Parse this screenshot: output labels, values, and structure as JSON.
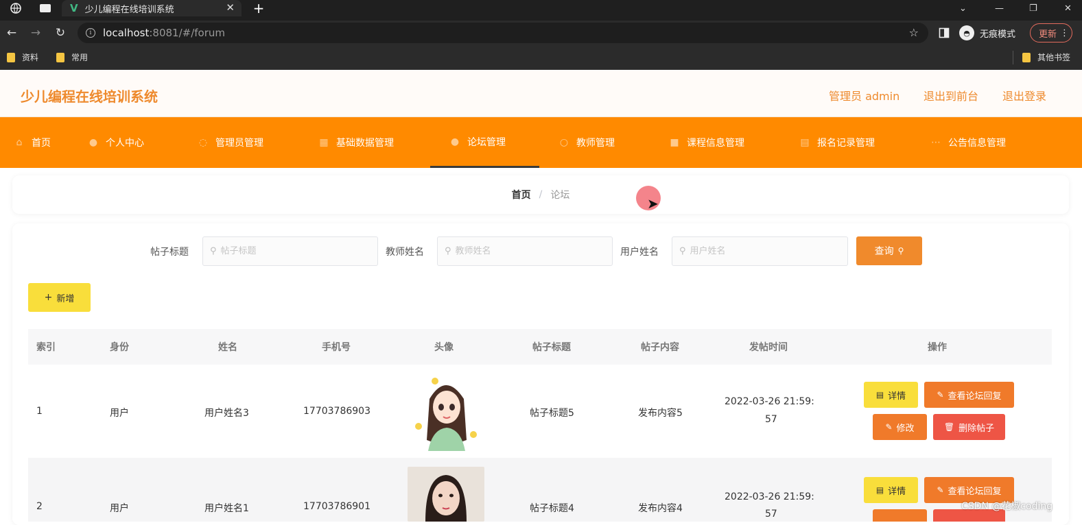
{
  "browser": {
    "tab_title": "少儿编程在线培训系统",
    "url_host": "localhost",
    "url_rest": ":8081/#/forum",
    "incognito_label": "无痕模式",
    "update_label": "更新",
    "bookmarks": [
      "资料",
      "常用"
    ],
    "other_bookmarks": "其他书签"
  },
  "header": {
    "title": "少儿编程在线培训系统",
    "admin_label": "管理员 admin",
    "to_front": "退出到前台",
    "logout": "退出登录"
  },
  "menu": {
    "items": [
      {
        "label": "首页",
        "icon": "home-icon"
      },
      {
        "label": "个人中心",
        "icon": "user-icon"
      },
      {
        "label": "管理员管理",
        "icon": "info-icon"
      },
      {
        "label": "基础数据管理",
        "icon": "database-icon"
      },
      {
        "label": "论坛管理",
        "icon": "user-icon"
      },
      {
        "label": "教师管理",
        "icon": "circle-icon"
      },
      {
        "label": "课程信息管理",
        "icon": "book-icon"
      },
      {
        "label": "报名记录管理",
        "icon": "list-icon"
      },
      {
        "label": "公告信息管理",
        "icon": "notice-icon"
      }
    ],
    "active_index": 4
  },
  "breadcrumb": {
    "home": "首页",
    "separator": "/",
    "current": "论坛"
  },
  "search": {
    "title_label": "帖子标题",
    "title_placeholder": "帖子标题",
    "teacher_label": "教师姓名",
    "teacher_placeholder": "教师姓名",
    "user_label": "用户姓名",
    "user_placeholder": "用户姓名",
    "query_button": "查询"
  },
  "toolbar": {
    "add_button": "新增"
  },
  "table": {
    "columns": [
      "索引",
      "身份",
      "姓名",
      "手机号",
      "头像",
      "帖子标题",
      "帖子内容",
      "发帖时间",
      "操作"
    ],
    "rows": [
      {
        "index": "1",
        "role": "用户",
        "name": "用户姓名3",
        "phone": "17703786903",
        "title": "帖子标题5",
        "content": "发布内容5",
        "time_line1": "2022-03-26 21:59:",
        "time_line2": "57"
      },
      {
        "index": "2",
        "role": "用户",
        "name": "用户姓名1",
        "phone": "17703786901",
        "title": "帖子标题4",
        "content": "发布内容4",
        "time_line1": "2022-03-26 21:59:",
        "time_line2": "57"
      }
    ],
    "actions": {
      "detail": "详情",
      "view_replies": "查看论坛回复",
      "edit": "修改",
      "delete": "删除帖子"
    }
  },
  "watermark": "CSDN @花椒coding",
  "colors": {
    "brand_orange": "#ff8a00",
    "title_orange": "#ee8a2d",
    "yellow_button": "#f9de3b",
    "orange_button": "#f07a2a",
    "red_button": "#ee5545"
  }
}
